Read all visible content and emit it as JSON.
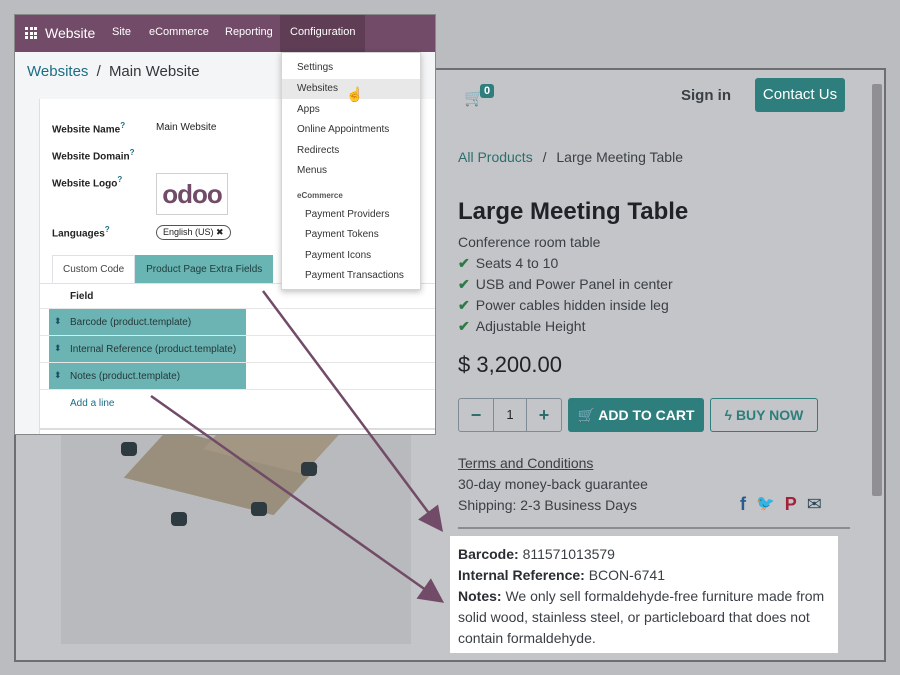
{
  "backend": {
    "brand": "Website",
    "menu": [
      "Site",
      "eCommerce",
      "Reporting",
      "Configuration"
    ],
    "breadcrumb_root": "Websites",
    "breadcrumb_sep": "/",
    "breadcrumb_current": "Main Website",
    "form": {
      "website_name_label": "Website Name",
      "website_name_value": "Main Website",
      "website_domain_label": "Website Domain",
      "website_logo_label": "Website Logo",
      "logo_text": "odoo",
      "languages_label": "Languages",
      "language_tag": "English (US) ✖",
      "tooltip_mark": "?"
    },
    "tabs": [
      "Custom Code",
      "Product Page Extra Fields"
    ],
    "field_header": "Field",
    "fields": [
      "Barcode (product.template)",
      "Internal Reference (product.template)",
      "Notes (product.template)"
    ],
    "handle_icon": "⬍",
    "add_line": "Add a line"
  },
  "dropdown": {
    "items": [
      "Settings",
      "Websites",
      "Apps",
      "Online Appointments",
      "Redirects",
      "Menus"
    ],
    "section": "eCommerce",
    "sub_items": [
      "Payment Providers",
      "Payment Tokens",
      "Payment Icons",
      "Payment Transactions"
    ]
  },
  "shop": {
    "cart_icon": "🛒",
    "cart_count": "0",
    "sign_in": "Sign in",
    "contact": "Contact Us",
    "crumb_root": "All Products",
    "crumb_sep": "/",
    "crumb_current": "Large Meeting Table",
    "title": "Large Meeting Table",
    "subtitle": "Conference room table",
    "features": [
      "Seats 4 to 10",
      "USB and Power Panel in center",
      "Power cables hidden inside leg",
      "Adjustable Height"
    ],
    "check_icon": "✔",
    "price": "$ 3,200.00",
    "qty_minus": "−",
    "qty_value": "1",
    "qty_plus": "+",
    "add_to_cart": "🛒  ADD TO CART",
    "buy_now": "ϟ BUY NOW",
    "terms": "Terms and Conditions",
    "guarantee": "30-day money-back guarantee",
    "shipping": "Shipping: 2-3 Business Days",
    "social": [
      {
        "glyph": "f",
        "color": "#2a5b8c"
      },
      {
        "glyph": "🐦",
        "color": "#3a8fc7"
      },
      {
        "glyph": "P",
        "color": "#a3213a"
      },
      {
        "glyph": "✉",
        "color": "#2d4a5c"
      }
    ],
    "barcode_label": "Barcode:",
    "barcode_value": "811571013579",
    "internal_ref_label": "Internal Reference:",
    "internal_ref_value": "BCON-6741",
    "notes_label": "Notes:",
    "notes_value": "We only sell formaldehyde-free furniture made from solid wood, stainless steel, or particleboard that does not contain formaldehyde."
  },
  "colors": {
    "odoo_purple": "#714b67",
    "teal": "#2d7e7c",
    "arrow": "#714b67"
  }
}
